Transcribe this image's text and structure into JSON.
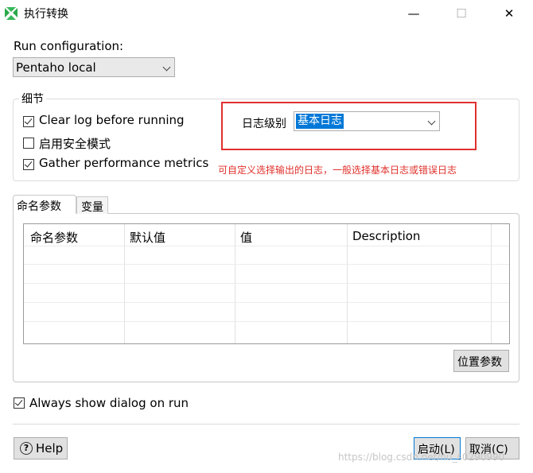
{
  "window": {
    "title": "执行转换",
    "minimize_glyph": "—",
    "maximize_glyph": "☐",
    "close_glyph": "✕",
    "icon": "pentaho-spoon-icon",
    "icon_color": "#2aa84a"
  },
  "run_config": {
    "label": "Run configuration:",
    "value": "Pentaho local"
  },
  "details": {
    "legend": "细节",
    "options": [
      {
        "label": "Clear log before running",
        "checked": true
      },
      {
        "label": "启用安全模式",
        "checked": false
      },
      {
        "label": "Gather performance metrics",
        "checked": true
      }
    ],
    "log_level_label": "日志级别",
    "log_level_value": "基本日志",
    "annotation": "可自定义选择输出的日志，一般选择基本日志或错误日志",
    "annotation_color": "#e0302a"
  },
  "tabs": [
    {
      "label": "命名参数",
      "active": true
    },
    {
      "label": "变量",
      "active": false
    }
  ],
  "params_table": {
    "columns": [
      "命名参数",
      "默认值",
      "值",
      "Description"
    ],
    "rows": []
  },
  "buttons": {
    "positional_params": "位置参数",
    "help": "Help",
    "start": "启动(L)",
    "cancel": "取消(C)"
  },
  "always_show": {
    "label": "Always show dialog on run",
    "checked": true
  },
  "watermark": "https://blog.csdn.net/hu_s0290990",
  "colors": {
    "selection": "#0078d7",
    "annotation_box": "#e03030"
  }
}
